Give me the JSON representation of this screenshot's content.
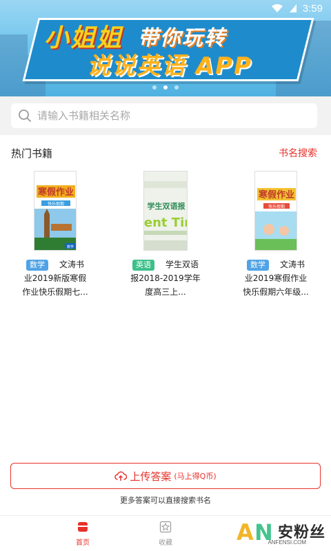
{
  "status_bar": {
    "time": "3:59"
  },
  "banner": {
    "line1_part1": "小姐姐",
    "line1_part2": "带你玩转",
    "line2": "说说英语 APP",
    "slide_count": 3,
    "active_slide": 2
  },
  "search": {
    "placeholder": "请输入书籍相关名称"
  },
  "hot_books": {
    "title": "热门书籍",
    "action": "书名搜索",
    "items": [
      {
        "subject": "数学",
        "title_lines": [
          "文涛书",
          "业2019新版寒假",
          "作业快乐假期七..."
        ],
        "cover_title": "寒假作业",
        "cover_subtitle": "快乐假期",
        "cover_badge": "数学",
        "tag_color": "#4fa3e6"
      },
      {
        "subject": "英语",
        "title_lines": [
          "学生双语",
          "报2018-2019学年",
          "度高三上..."
        ],
        "cover_title": "学生双语报",
        "cover_subtitle": "dent Tim",
        "tag_color": "#3cc08a"
      },
      {
        "subject": "数学",
        "title_lines": [
          "文涛书",
          "业2019寒假作业",
          "快乐假期六年级..."
        ],
        "cover_title": "寒假作业",
        "cover_subtitle": "快乐假期",
        "tag_color": "#4fa3e6"
      }
    ]
  },
  "upload": {
    "label": "上传答案",
    "sublabel": "(马上得Q币)",
    "hint": "更多答案可以直接搜索书名"
  },
  "bottom_nav": {
    "home_label": "首页",
    "favorites_label": "收藏"
  },
  "watermark": {
    "text": "安粉丝",
    "sub": "ANFENSI.COM"
  },
  "colors": {
    "accent": "#e8302a",
    "banner_blue": "#1e8ccc"
  }
}
